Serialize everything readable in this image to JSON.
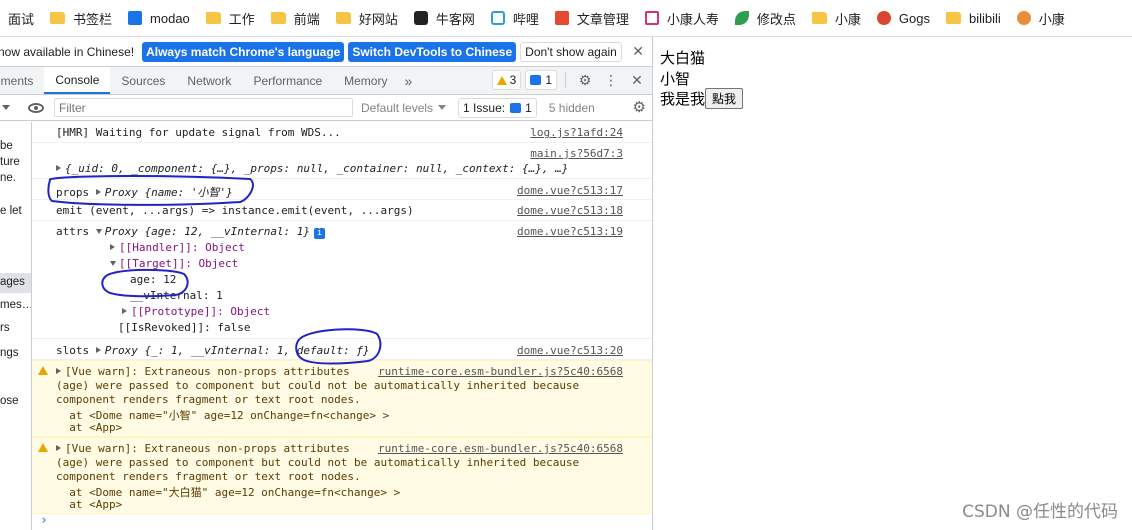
{
  "bookmarks": [
    {
      "label": "面试",
      "icon": "folder-icon"
    },
    {
      "label": "书签栏",
      "icon": "folder-icon"
    },
    {
      "label": "modao",
      "icon": "modao-icon"
    },
    {
      "label": "工作",
      "icon": "folder-icon"
    },
    {
      "label": "前端",
      "icon": "folder-icon"
    },
    {
      "label": "好网站",
      "icon": "folder-icon"
    },
    {
      "label": "牛客网",
      "icon": "nowcoder-icon"
    },
    {
      "label": "哔哩",
      "icon": "bilibili-tv-icon"
    },
    {
      "label": "文章管理",
      "icon": "csdn-icon"
    },
    {
      "label": "小康人寿",
      "icon": "m-icon"
    },
    {
      "label": "修改点",
      "icon": "leaf-icon"
    },
    {
      "label": "小康",
      "icon": "folder-icon"
    },
    {
      "label": "Gogs",
      "icon": "gogs-icon"
    },
    {
      "label": "bilibili",
      "icon": "folder-icon"
    },
    {
      "label": "小康",
      "icon": "avatar-icon"
    }
  ],
  "infobar": {
    "text": "now available in Chinese!",
    "btn_match": "Always match Chrome's language",
    "btn_switch": "Switch DevTools to Chinese",
    "btn_dont": "Don't show again",
    "close": "✕"
  },
  "tabs": {
    "elements": "ements",
    "console": "Console",
    "sources": "Sources",
    "network": "Network",
    "performance": "Performance",
    "memory": "Memory",
    "more": "»",
    "warn_count": "3",
    "msg_count": "1"
  },
  "filterbar": {
    "filter_placeholder": "Filter",
    "levels": "Default levels",
    "issue_label": "1 Issue:",
    "issue_count": "1",
    "hidden": "5 hidden"
  },
  "sidebar": [
    "be",
    "ture",
    "ne.",
    "e let",
    "ages",
    "mes…",
    "rs",
    "ngs",
    "ose"
  ],
  "console": {
    "hmr_text": "[HMR] Waiting for update signal from WDS...",
    "hmr_src": "log.js?1afd:24",
    "main_src": "main.js?56d7:3",
    "obj_line": "{_uid: 0, _component: {…}, _props: null, _container: null, _context: {…}, …}",
    "props_label": "props",
    "props_value": "Proxy {name: '小智'}",
    "props_src": "dome.vue?c513:17",
    "emit_line": "emit (event, ...args) => instance.emit(event, ...args)",
    "emit_src": "dome.vue?c513:18",
    "attrs_label": "attrs",
    "attrs_value": "Proxy {age: 12, __vInternal: 1}",
    "attrs_src": "dome.vue?c513:19",
    "handler": "[[Handler]]: Object",
    "target": "[[Target]]: Object",
    "age": "age: 12",
    "vinternal": "__vInternal: 1",
    "prototype": "[[Prototype]]: Object",
    "revoked": "[[IsRevoked]]: false",
    "slots_label": "slots",
    "slots_value": "Proxy {_: 1, __vInternal: 1, default: ƒ}",
    "slots_src": "dome.vue?c513:20",
    "warn1": [
      "[Vue warn]: Extraneous non-props attributes",
      "(age) were passed to component but could not be automatically inherited because",
      "component renders fragment or text root nodes.",
      "  at <Dome name=\"小智\" age=12 onChange=fn<change> >",
      "  at <App>"
    ],
    "warn2": [
      "[Vue warn]: Extraneous non-props attributes",
      "(age) were passed to component but could not be automatically inherited because",
      "component renders fragment or text root nodes.",
      "  at <Dome name=\"大白猫\" age=12 onChange=fn<change> >",
      "  at <App>"
    ],
    "warn_src": "runtime-core.esm-bundler.js?5c40:6568",
    "prompt": "›"
  },
  "page": {
    "line1": "大白猫",
    "line2": "小智",
    "line3": "我是我",
    "button": "點我"
  },
  "watermark": "CSDN @任性的代码",
  "colors": {
    "accent": "#1a73e8",
    "warn_bg": "#fffbe5",
    "annotation": "#1f23c8"
  }
}
